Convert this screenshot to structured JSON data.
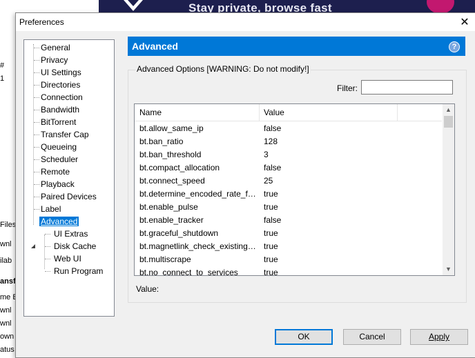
{
  "background": {
    "banner_text": "Stay private, browse fast",
    "left_fragments": [
      "#",
      "1",
      "Files",
      "wnl",
      "ilab",
      "ansf",
      "me E",
      "wnl",
      "wnl",
      "own",
      "atus"
    ]
  },
  "dialog": {
    "title": "Preferences",
    "close_label": "✕"
  },
  "tree": {
    "items": [
      {
        "label": "General",
        "level": 0
      },
      {
        "label": "Privacy",
        "level": 0
      },
      {
        "label": "UI Settings",
        "level": 0
      },
      {
        "label": "Directories",
        "level": 0
      },
      {
        "label": "Connection",
        "level": 0
      },
      {
        "label": "Bandwidth",
        "level": 0
      },
      {
        "label": "BitTorrent",
        "level": 0
      },
      {
        "label": "Transfer Cap",
        "level": 0
      },
      {
        "label": "Queueing",
        "level": 0
      },
      {
        "label": "Scheduler",
        "level": 0
      },
      {
        "label": "Remote",
        "level": 0
      },
      {
        "label": "Playback",
        "level": 0
      },
      {
        "label": "Paired Devices",
        "level": 0
      },
      {
        "label": "Label",
        "level": 0
      },
      {
        "label": "Advanced",
        "level": 0,
        "selected": true,
        "expanded": true
      },
      {
        "label": "UI Extras",
        "level": 1
      },
      {
        "label": "Disk Cache",
        "level": 1
      },
      {
        "label": "Web UI",
        "level": 1
      },
      {
        "label": "Run Program",
        "level": 1
      }
    ]
  },
  "panel": {
    "title": "Advanced",
    "help_label": "?",
    "group_label": "Advanced Options [WARNING: Do not modify!]",
    "filter_label": "Filter:",
    "filter_value": "",
    "columns": [
      "Name",
      "Value"
    ],
    "rows": [
      {
        "name": "bt.allow_same_ip",
        "value": "false"
      },
      {
        "name": "bt.ban_ratio",
        "value": "128"
      },
      {
        "name": "bt.ban_threshold",
        "value": "3"
      },
      {
        "name": "bt.compact_allocation",
        "value": "false"
      },
      {
        "name": "bt.connect_speed",
        "value": "25"
      },
      {
        "name": "bt.determine_encoded_rate_fo...",
        "value": "true"
      },
      {
        "name": "bt.enable_pulse",
        "value": "true"
      },
      {
        "name": "bt.enable_tracker",
        "value": "false"
      },
      {
        "name": "bt.graceful_shutdown",
        "value": "true"
      },
      {
        "name": "bt.magnetlink_check_existing_...",
        "value": "true"
      },
      {
        "name": "bt.multiscrape",
        "value": "true"
      },
      {
        "name": "bt.no_connect_to_services",
        "value": "true"
      }
    ],
    "value_label": "Value:"
  },
  "buttons": {
    "ok": "OK",
    "cancel": "Cancel",
    "apply": "Apply"
  },
  "colors": {
    "accent": "#0078d7"
  }
}
